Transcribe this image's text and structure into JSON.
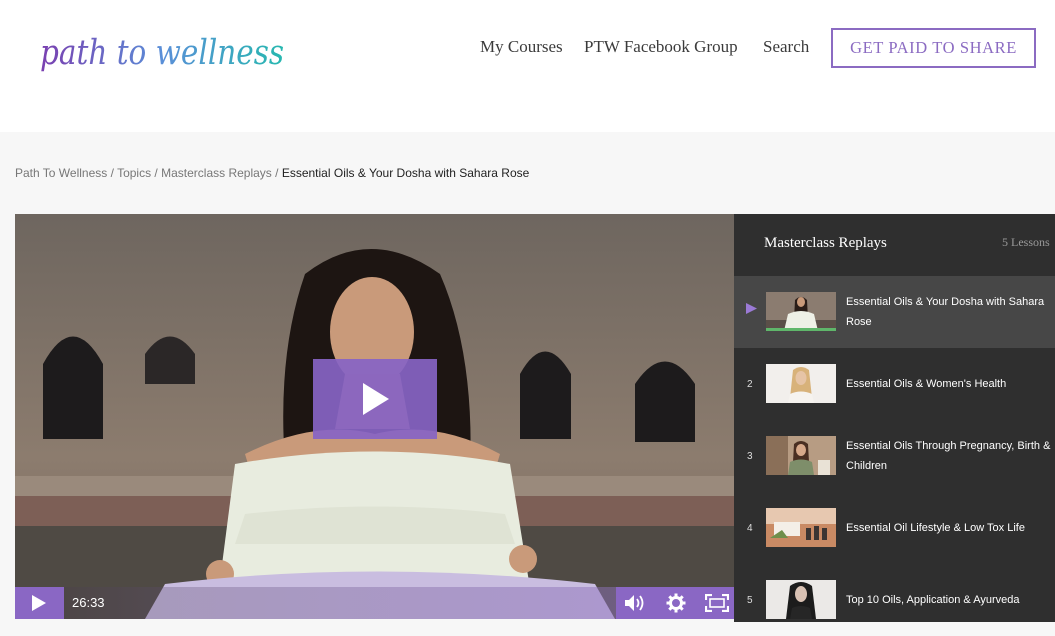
{
  "header": {
    "logo_text": "path to wellness",
    "nav": [
      "My Courses",
      "PTW Facebook Group",
      "Search"
    ],
    "cta": "GET PAID TO SHARE"
  },
  "breadcrumb": {
    "items": [
      "Path To Wellness",
      "Topics",
      "Masterclass Replays"
    ],
    "current": "Essential Oils & Your Dosha with Sahara Rose",
    "separator": " / "
  },
  "player": {
    "time": "26:33",
    "accent_color": "#8a67c4"
  },
  "sidebar": {
    "title": "Masterclass Replays",
    "count": "5 Lessons",
    "lessons": [
      {
        "num": "",
        "title": "Essential Oils & Your Dosha with Sahara Rose",
        "active": true
      },
      {
        "num": "2",
        "title": "Essential Oils & Women's Health",
        "active": false
      },
      {
        "num": "3",
        "title": "Essential Oils Through Pregnancy, Birth & Children",
        "active": false
      },
      {
        "num": "4",
        "title": "Essential Oil Lifestyle & Low Tox Life",
        "active": false
      },
      {
        "num": "5",
        "title": "Top 10 Oils, Application & Ayurveda",
        "active": false
      }
    ]
  }
}
